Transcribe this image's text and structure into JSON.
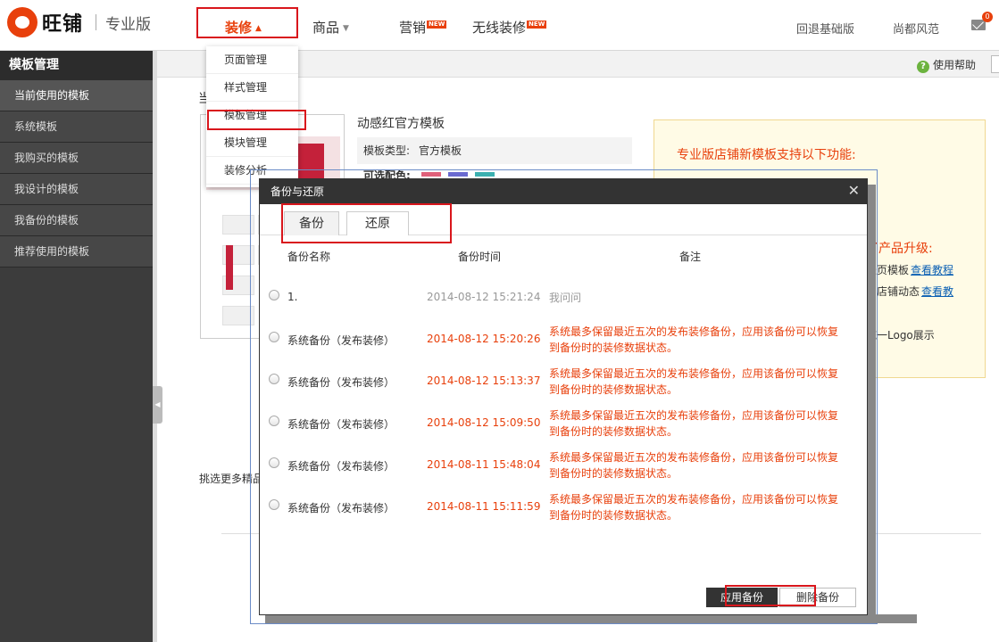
{
  "header": {
    "brand": "旺铺",
    "edition": "专业版",
    "nav": [
      {
        "label": "装修",
        "active": true
      },
      {
        "label": "商品"
      },
      {
        "label": "营销",
        "badge": "NEW"
      },
      {
        "label": "无线装修",
        "badge": "NEW"
      }
    ],
    "revert_link": "回退基础版",
    "shop_name": "尚都风范",
    "mail_count": "0"
  },
  "dropdown": {
    "items": [
      "页面管理",
      "样式管理",
      "模板管理",
      "模块管理",
      "装修分析"
    ]
  },
  "sidebar": {
    "title": "模板管理",
    "items": [
      "当前使用的模板",
      "系统模板",
      "我购买的模板",
      "我设计的模板",
      "我备份的模板",
      "推荐使用的模板"
    ]
  },
  "main": {
    "help": "使用帮助",
    "current_label": "当",
    "template_name": "动感红官方模板",
    "template_type_label": "模板类型:",
    "template_type_value": "官方模板",
    "colors_label": "可选配色:",
    "more_label": "挑选更多精品",
    "upgrade": {
      "title": "专业版店铺新模板支持以下功能:",
      "subtitle": "了产品升级:",
      "line1": "表页模板",
      "line1_link": "查看教程",
      "line2": "为店铺动态",
      "line2_link": "查看教",
      "line3": "统一Logo展示"
    }
  },
  "modal": {
    "title": "备份与还原",
    "tabs": [
      "备份",
      "还原"
    ],
    "columns": [
      "备份名称",
      "备份时间",
      "备注"
    ],
    "rows": [
      {
        "name": "1.",
        "time": "2014-08-12 15:21:24",
        "note": "我问问"
      },
      {
        "name": "系统备份（发布装修）",
        "time": "2014-08-12 15:20:26",
        "note": "系统最多保留最近五次的发布装修备份，应用该备份可以恢复到备份时的装修数据状态。"
      },
      {
        "name": "系统备份（发布装修）",
        "time": "2014-08-12 15:13:37",
        "note": "系统最多保留最近五次的发布装修备份，应用该备份可以恢复到备份时的装修数据状态。"
      },
      {
        "name": "系统备份（发布装修）",
        "time": "2014-08-12 15:09:50",
        "note": "系统最多保留最近五次的发布装修备份，应用该备份可以恢复到备份时的装修数据状态。"
      },
      {
        "name": "系统备份（发布装修）",
        "time": "2014-08-11 15:48:04",
        "note": "系统最多保留最近五次的发布装修备份，应用该备份可以恢复到备份时的装修数据状态。"
      },
      {
        "name": "系统备份（发布装修）",
        "time": "2014-08-11 15:11:59",
        "note": "系统最多保留最近五次的发布装修备份，应用该备份可以恢复到备份时的装修数据状态。"
      }
    ],
    "apply_button": "应用备份",
    "delete_button": "删除备份"
  },
  "colors": {
    "accent": "#e8400c",
    "highlight_box": "#d9161c",
    "note_text": "#e8400c",
    "time_text_system": "#e8400c",
    "time_text_user": "#999999"
  }
}
